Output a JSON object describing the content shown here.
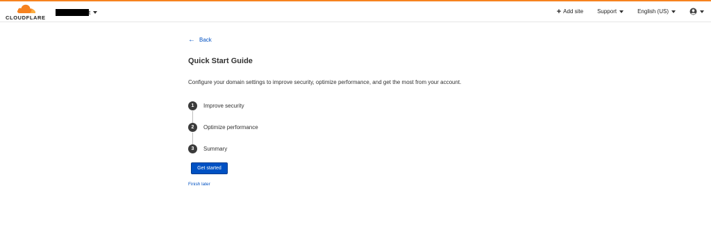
{
  "header": {
    "logo_text": "CLOUDFLARE",
    "account_suffix": "t",
    "add_site": "Add site",
    "support": "Support",
    "language": "English (US)"
  },
  "main": {
    "back": "Back",
    "title": "Quick Start Guide",
    "description": "Configure your domain settings to improve security, optimize performance, and get the most from your account.",
    "steps": [
      {
        "num": "1",
        "label": "Improve security"
      },
      {
        "num": "2",
        "label": "Optimize performance"
      },
      {
        "num": "3",
        "label": "Summary"
      }
    ],
    "primary_button": "Get started",
    "secondary_link": "Finish later"
  },
  "colors": {
    "accent": "#f6821f",
    "link": "#0051c3",
    "step_circle": "#3b3b3b"
  }
}
